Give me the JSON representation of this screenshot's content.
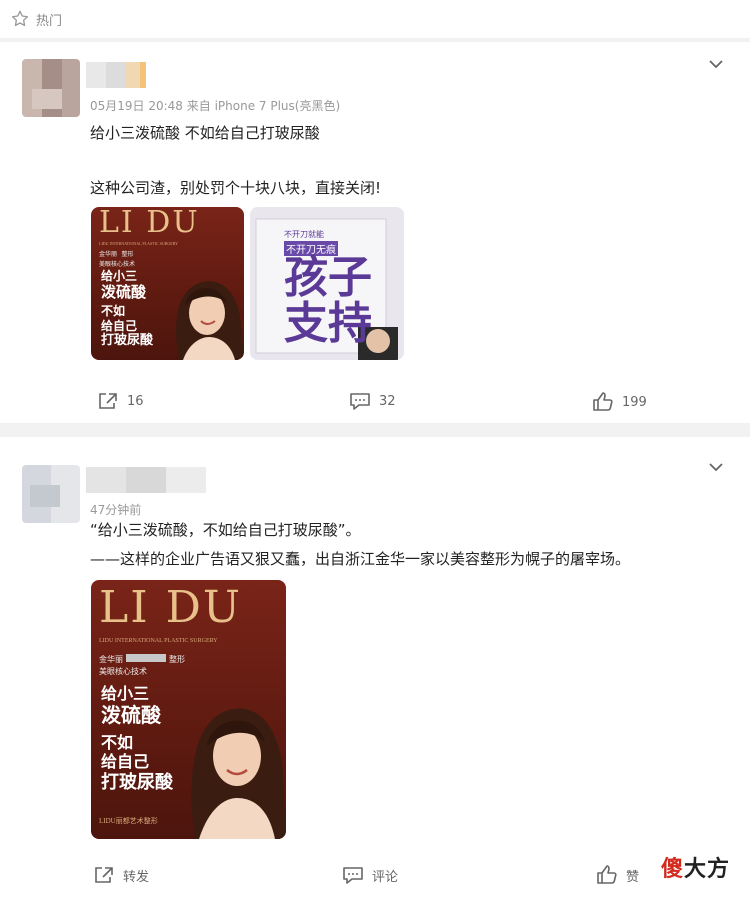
{
  "header": {
    "hot_label": "热门",
    "icon": "star-outline-icon"
  },
  "posts": [
    {
      "meta": "05月19日 20:48  来自 iPhone 7 Plus(亮黑色)",
      "line1": "给小三泼硫酸 不如给自己打玻尿酸",
      "line2": "这种公司渣，别处罚个十块八块，直接关闭!",
      "poster": {
        "brand": "LI DU",
        "sub": "LIDU INTERNATIONAL PLASTIC SURGERY",
        "sub2": "金华丽",
        "sub3": "整形",
        "sub4": "美眼核心技术",
        "lines": [
          "给小三",
          "泼硫酸",
          "不如",
          "给自己",
          "打玻尿酸"
        ]
      },
      "sign": {
        "small1": "不开刀就能",
        "small2": "不开刀无痕",
        "big1": "孩子",
        "big2": "支持"
      },
      "actions": {
        "share": "16",
        "comment": "32",
        "like": "199"
      }
    },
    {
      "meta": "47分钟前",
      "line1": "“给小三泼硫酸，不如给自己打玻尿酸”。",
      "line2": "——这样的企业广告语又狠又蠢，出自浙江金华一家以美容整形为幌子的屠宰场。",
      "poster": {
        "brand": "LI DU",
        "sub": "LIDU INTERNATIONAL PLASTIC SURGERY",
        "sub2": "金华丽",
        "sub3": "整形",
        "sub4": "美眼核心技术",
        "lines": [
          "给小三",
          "泼硫酸",
          "不如",
          "给自己",
          "打玻尿酸"
        ],
        "footer": "LIDU丽都艺术整形"
      },
      "actions": {
        "share": "转发",
        "comment": "评论",
        "like": "赞"
      }
    }
  ],
  "watermark": {
    "part1": "傻",
    "part2": "大方"
  },
  "colors": {
    "accent_red": "#d42a1e",
    "poster_bg": "#6e1f15",
    "poster_gold": "#e8c089",
    "sign_purple": "#5a3a96"
  }
}
